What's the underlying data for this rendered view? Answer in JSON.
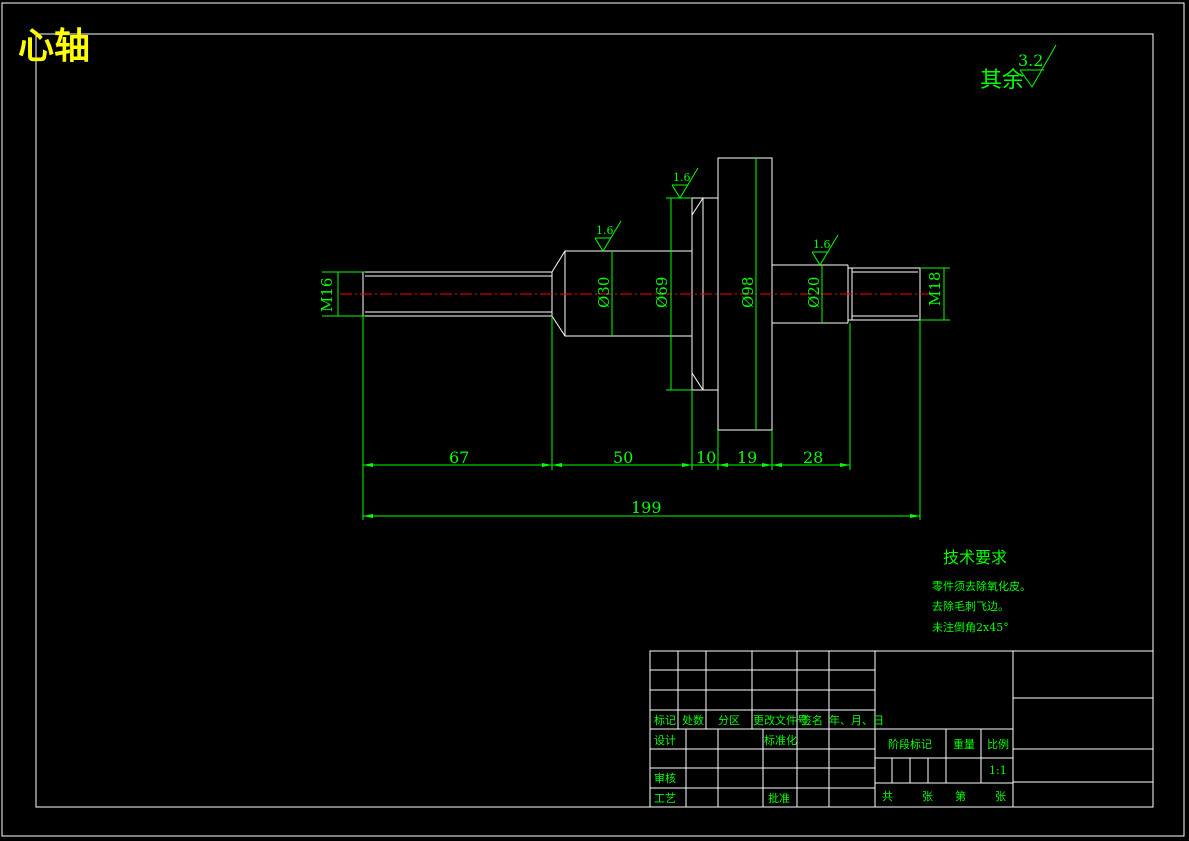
{
  "drawing": {
    "title": "心轴",
    "roughness_general": {
      "label": "其余",
      "value": "3.2"
    },
    "roughness_marks": [
      "1.6",
      "1.6",
      "1.6"
    ],
    "diameters": [
      "M16",
      "Ø30",
      "Ø69",
      "Ø98",
      "Ø20",
      "M18"
    ],
    "lengths": [
      "67",
      "50",
      "10",
      "19",
      "28"
    ],
    "total_length": "199"
  },
  "tech_requirements": {
    "title": "技术要求",
    "items": [
      "零件须去除氧化皮。",
      "去除毛刺飞边。",
      "未注倒角2x45°"
    ]
  },
  "title_block": {
    "header_row": [
      "标记",
      "处数",
      "分区",
      "更改文件号",
      "签名",
      "年、月、日"
    ],
    "design": "设计",
    "standardize": "标准化",
    "review": "审核",
    "process": "工艺",
    "approve": "批准",
    "stage_mark": "阶段标记",
    "weight": "重量",
    "scale_label": "比例",
    "scale_value": "1:1",
    "total": "共",
    "sheets1": "张",
    "sheet_no": "第",
    "sheets2": "张"
  },
  "colors": {
    "outline": "#ffffff",
    "dimension": "#00ff00",
    "centerline": "#ff0000",
    "title": "#ffff00"
  }
}
